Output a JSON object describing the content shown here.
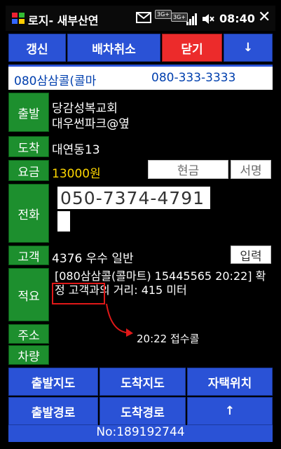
{
  "status": {
    "title": "로지- 새부산연",
    "badge1": "3G+",
    "badge2": "3G+",
    "time": "08:40",
    "close": "✕"
  },
  "topbar": {
    "refresh": "갱신",
    "cancel_dispatch": "배차취소",
    "close": "닫기",
    "down": "↓"
  },
  "number_row": {
    "name": "080삼삼콜(콜마",
    "number": "080-333-3333"
  },
  "rows": {
    "depart_label": "출발",
    "depart_line1": "당감성복교회",
    "depart_line2": "대우썬파크@옆",
    "arrive_label": "도착",
    "arrive_value": "대연동13",
    "fare_label": "요금",
    "fare_value": "13000원",
    "cash": "현금",
    "sign": "서명",
    "phone_label": "전화",
    "phone_value": "050-7374-4791",
    "customer_label": "고객",
    "customer_value": "4376 우수 일반",
    "input_button": "입력",
    "memo_label": "적요",
    "memo_text": "[080삼삼콜(콜마트) 15445565 20:22] 확정 고객과의 거리: 415 미터",
    "address_label": "주소",
    "vehicle_label": "차량"
  },
  "bottom": {
    "depart_map": "출발지도",
    "arrive_map": "도착지도",
    "my_location": "자택위치",
    "depart_route": "출발경로",
    "arrive_route": "도착경로",
    "up": "↑"
  },
  "footer": "No:189192744",
  "annotation": "20:22 접수콜",
  "colors": {
    "button_blue": "#2a52d6",
    "close_red": "#ec2b2b",
    "label_green": "#1d8f2e",
    "fare_yellow": "#ffd700"
  }
}
